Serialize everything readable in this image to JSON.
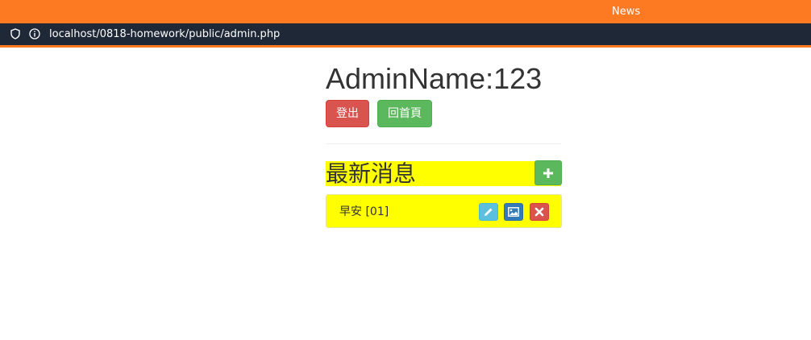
{
  "browser": {
    "tab_label": "News",
    "url": "localhost/0818-homework/public/admin.php",
    "colors": {
      "accent": "#fd7a23",
      "urlbar": "#1f2837"
    }
  },
  "page": {
    "admin_title": "AdminName:123",
    "buttons": {
      "logout": "登出",
      "home": "回首頁"
    },
    "news": {
      "heading": "最新消息",
      "add_icon": "plus-icon",
      "items": [
        {
          "label": "早安 [01]",
          "actions": [
            "pencil-icon",
            "image-icon",
            "remove-icon"
          ]
        }
      ]
    },
    "colors": {
      "highlight": "#ffff00",
      "danger": "#d9534f",
      "success": "#5cb85c",
      "info": "#5bc0de",
      "primary": "#337ab7"
    }
  }
}
